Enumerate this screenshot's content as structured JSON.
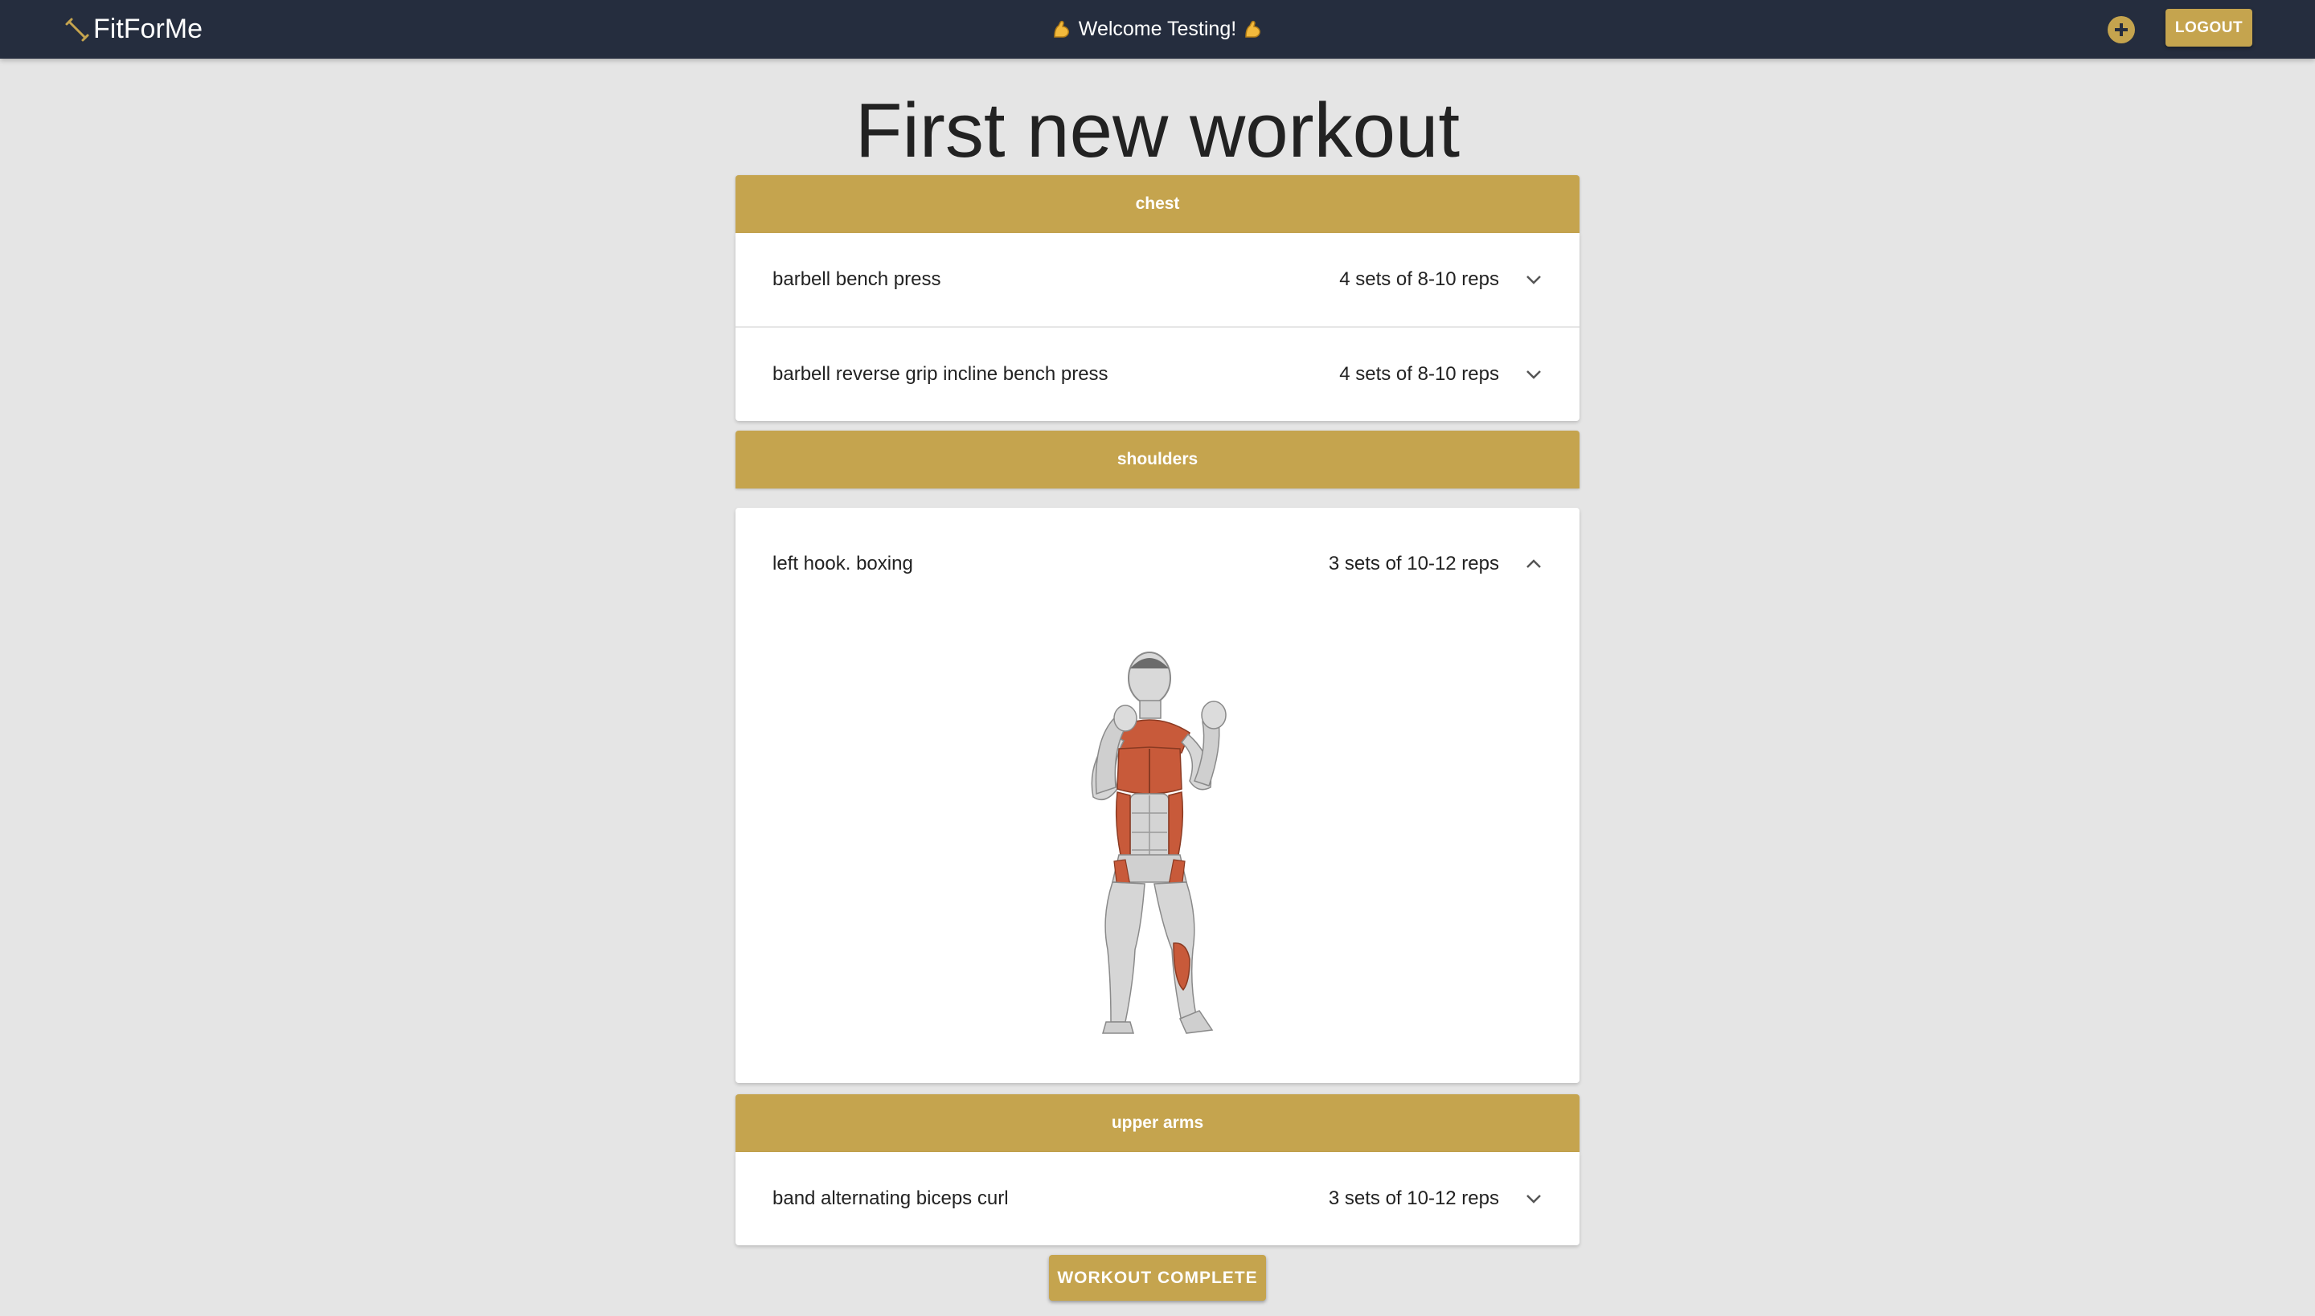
{
  "colors": {
    "appbar": "#252d3e",
    "accent": "#c5a44e",
    "background": "#e5e5e5",
    "card": "#ffffff"
  },
  "header": {
    "brand": "FitForMe",
    "brand_icon": "dumbbell-icon",
    "welcome": "Welcome Testing!",
    "welcome_icon": "flexed-biceps-emoji",
    "add_icon": "plus-circle-icon",
    "logout_label": "LOGOUT"
  },
  "workout": {
    "title": "First new workout",
    "groups": [
      {
        "label": "chest",
        "exercises": [
          {
            "name": "barbell bench press",
            "sets": "4 sets of 8-10 reps",
            "expanded": false
          },
          {
            "name": "barbell reverse grip incline bench press",
            "sets": "4 sets of 8-10 reps",
            "expanded": false
          }
        ]
      },
      {
        "label": "shoulders",
        "exercises": [
          {
            "name": "left hook. boxing",
            "sets": "3 sets of 10-12 reps",
            "expanded": true,
            "image": "anatomy-figure-boxing-stance"
          }
        ]
      },
      {
        "label": "upper arms",
        "exercises": [
          {
            "name": "band alternating biceps curl",
            "sets": "3 sets of 10-12 reps",
            "expanded": false
          }
        ]
      }
    ],
    "complete_label": "WORKOUT COMPLETE"
  }
}
